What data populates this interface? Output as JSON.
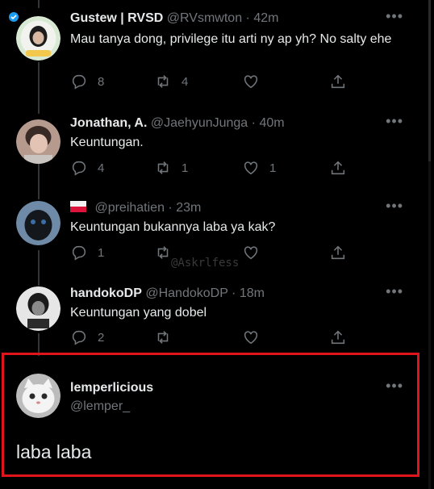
{
  "tweets": [
    {
      "name": "Gustew | RVSD",
      "handle": "@RVsmwton",
      "time": "42m",
      "flag": "",
      "text": "Mau tanya dong, privilege itu arti ny ap yh? No salty ehe",
      "replies": "8",
      "retweets": "4",
      "likes": ""
    },
    {
      "name": "Jonathan, A.",
      "handle": "@JaehyunJunga",
      "time": "40m",
      "flag": "",
      "text": "Keuntungan.",
      "replies": "4",
      "retweets": "1",
      "likes": "1"
    },
    {
      "name": "",
      "handle": "@preihatien",
      "time": "23m",
      "flag": "flag",
      "text": "Keuntungan bukannya laba ya kak?",
      "replies": "1",
      "retweets": "",
      "likes": ""
    },
    {
      "name": "handokoDP",
      "handle": "@HandokoDP",
      "time": "18m",
      "flag": "",
      "text": "Keuntungan yang dobel",
      "replies": "2",
      "retweets": "",
      "likes": ""
    }
  ],
  "focused": {
    "name": "lemperlicious",
    "handle": "@lemper_",
    "text": "laba laba"
  },
  "watermark": "@Askrlfess",
  "more_label": "•••",
  "separator": "·",
  "colors": {
    "bg": "#000000",
    "text": "#e7e9ea",
    "muted": "#71767b",
    "highlight": "#e0141b"
  }
}
